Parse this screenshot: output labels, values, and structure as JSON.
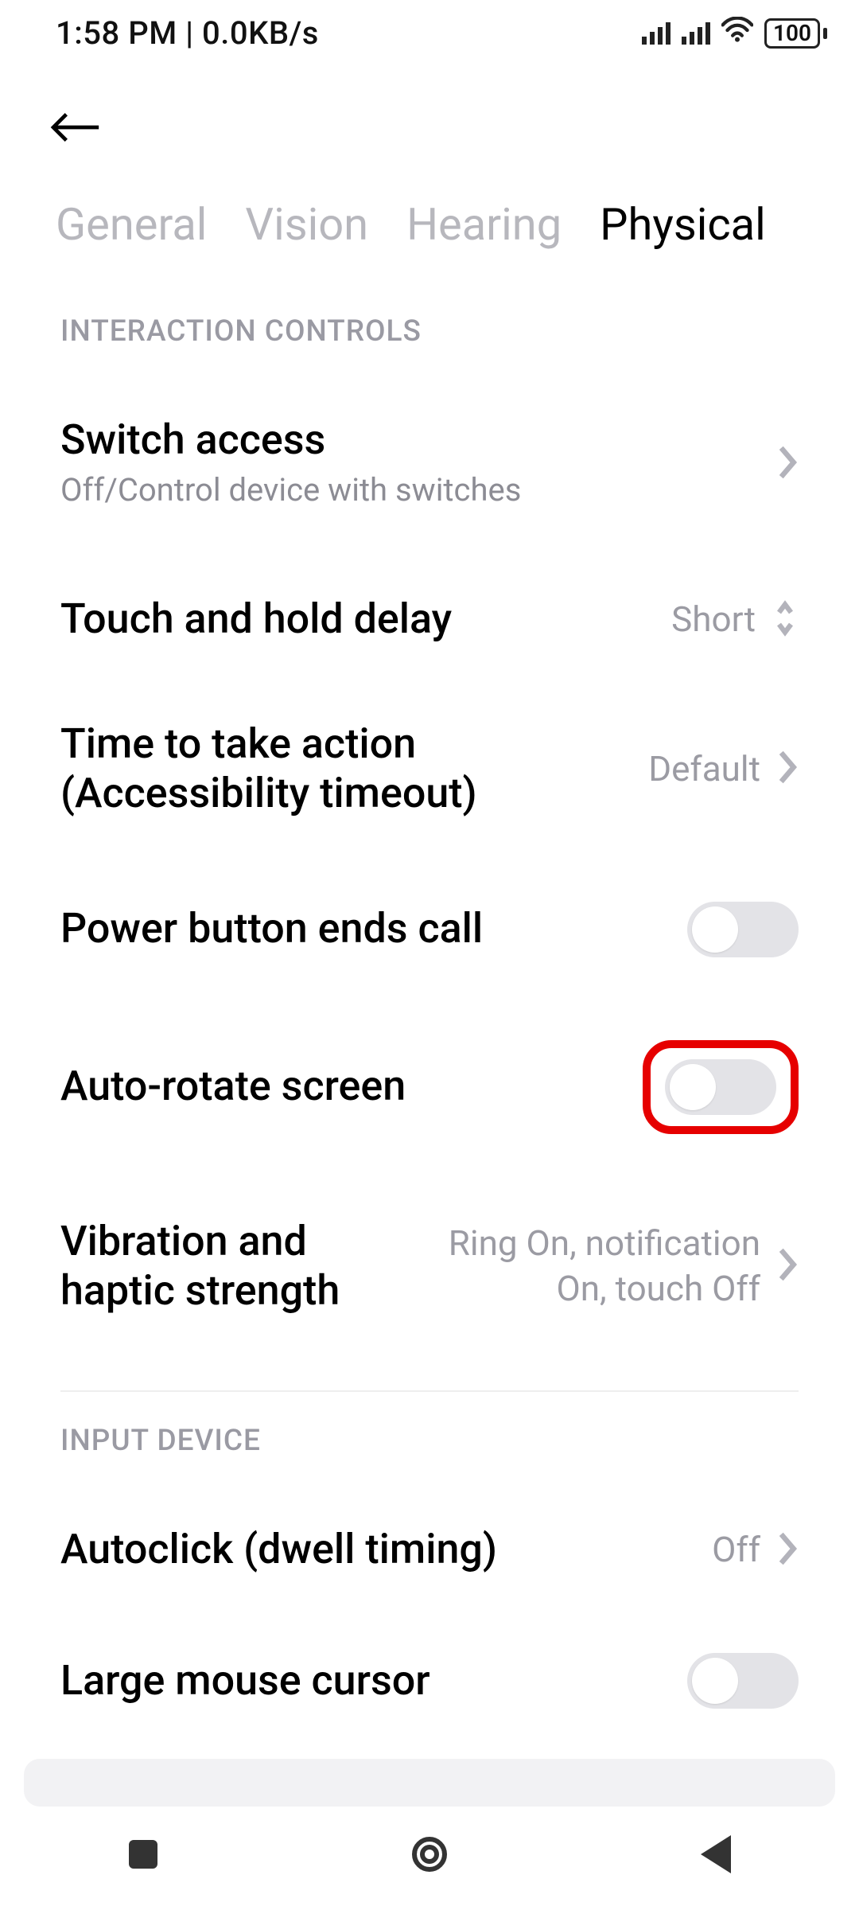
{
  "status": {
    "time": "1:58 PM | 0.0KB/s",
    "battery": "100"
  },
  "tabs": {
    "general": "General",
    "vision": "Vision",
    "hearing": "Hearing",
    "physical": "Physical"
  },
  "sections": {
    "interaction": {
      "header": "INTERACTION CONTROLS",
      "switch_access": {
        "title": "Switch access",
        "subtitle": "Off/Control device with switches"
      },
      "touch_hold": {
        "title": "Touch and hold delay",
        "value": "Short"
      },
      "timeout": {
        "title": "Time to take action (Accessibility timeout)",
        "value": "Default"
      },
      "power_end_call": {
        "title": "Power button ends call"
      },
      "auto_rotate": {
        "title": "Auto-rotate screen"
      },
      "vibration": {
        "title": "Vibration and haptic strength",
        "value": "Ring On, notification On, touch Off"
      }
    },
    "input_device": {
      "header": "INPUT DEVICE",
      "autoclick": {
        "title": "Autoclick (dwell timing)",
        "value": "Off"
      },
      "large_cursor": {
        "title": "Large mouse cursor"
      }
    }
  }
}
